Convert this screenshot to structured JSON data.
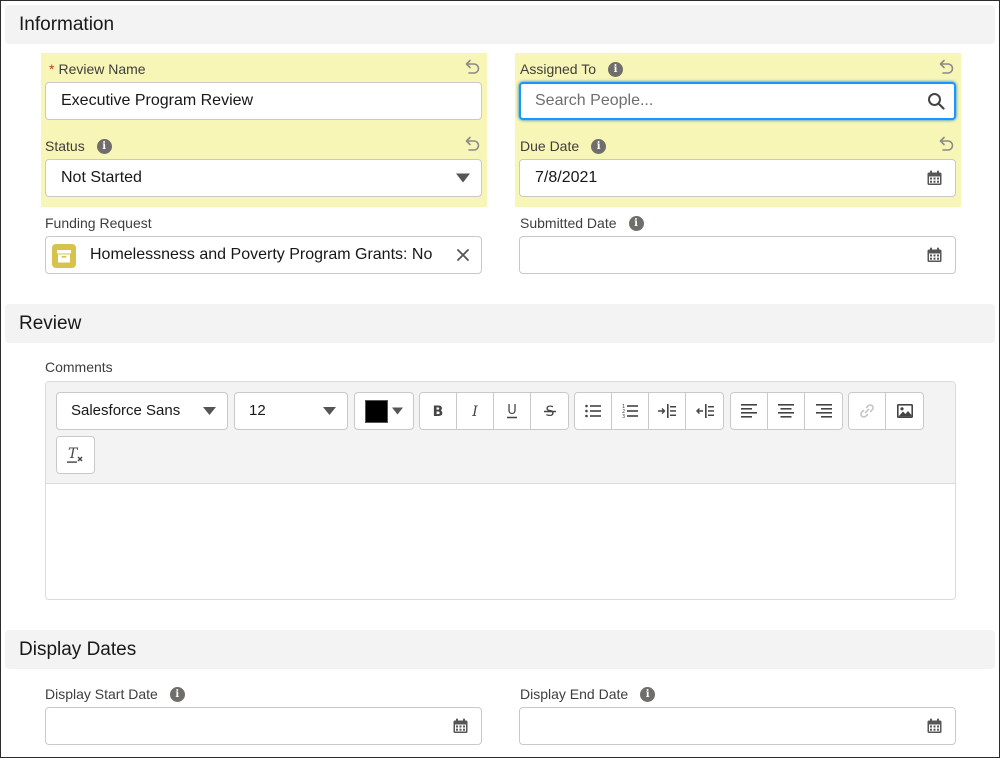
{
  "sections": {
    "information": "Information",
    "review": "Review",
    "display_dates": "Display Dates"
  },
  "required_marker": "*",
  "fields": {
    "review_name": {
      "label": "Review Name",
      "value": "Executive Program Review"
    },
    "assigned_to": {
      "label": "Assigned To",
      "placeholder": "Search People..."
    },
    "status": {
      "label": "Status",
      "value": "Not Started"
    },
    "due_date": {
      "label": "Due Date",
      "value": "7/8/2021"
    },
    "funding_request": {
      "label": "Funding Request",
      "value": "Homelessness and Poverty Program Grants: No"
    },
    "submitted_date": {
      "label": "Submitted Date",
      "value": ""
    },
    "comments": {
      "label": "Comments",
      "value": ""
    },
    "display_start_date": {
      "label": "Display Start Date",
      "value": ""
    },
    "display_end_date": {
      "label": "Display End Date",
      "value": ""
    }
  },
  "editor": {
    "font_family": "Salesforce Sans",
    "font_size": "12",
    "text_color": "#000000",
    "buttons": [
      "bold",
      "italic",
      "underline",
      "strikethrough",
      "bulleted-list",
      "numbered-list",
      "indent",
      "outdent",
      "align-left",
      "align-center",
      "align-right",
      "link",
      "image",
      "clear-formatting"
    ]
  },
  "colors": {
    "highlight": "#f8f6b6",
    "focus_border": "#1b96ff",
    "required": "#c23934",
    "funding_icon_bg": "#d5c34b"
  }
}
